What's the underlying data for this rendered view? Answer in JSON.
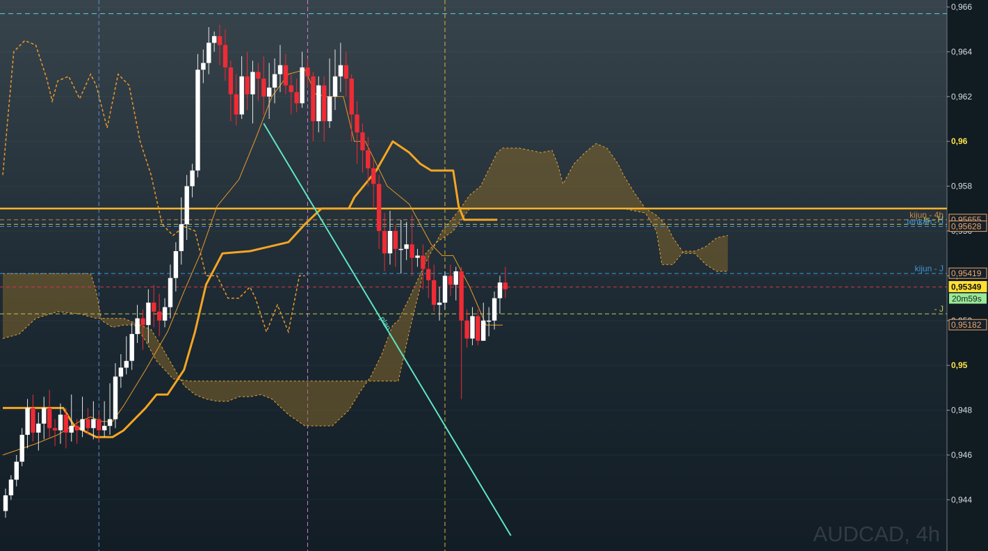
{
  "chart_data": {
    "type": "candlestick",
    "symbol_label": "AUDCAD, 4h",
    "ylim": [
      0.9425,
      0.9665
    ],
    "y_ticks": [
      {
        "v": 0.966,
        "label": "0,966",
        "bold": false
      },
      {
        "v": 0.964,
        "label": "0,964",
        "bold": false
      },
      {
        "v": 0.962,
        "label": "0,962",
        "bold": false
      },
      {
        "v": 0.96,
        "label": "0,96",
        "bold": true
      },
      {
        "v": 0.958,
        "label": "0,958",
        "bold": false
      },
      {
        "v": 0.956,
        "label": "0,956",
        "bold": false
      },
      {
        "v": 0.954,
        "label": "0,954",
        "bold": false
      },
      {
        "v": 0.952,
        "label": "0,952",
        "bold": false
      },
      {
        "v": 0.95,
        "label": "0,95",
        "bold": true
      },
      {
        "v": 0.948,
        "label": "0,948",
        "bold": false
      },
      {
        "v": 0.946,
        "label": "0,946",
        "bold": false
      },
      {
        "v": 0.944,
        "label": "0,944",
        "bold": false
      }
    ],
    "bar_count": 92,
    "vertical_markers": [
      {
        "bar": 17.5,
        "color": "#5b8fd6"
      },
      {
        "bar": 55.5,
        "color": "#d77ad8"
      },
      {
        "bar": 80.5,
        "color": "#e0b43c"
      }
    ],
    "candles": [
      [
        0.9435,
        0.9442,
        0.9432,
        0.9445
      ],
      [
        0.9442,
        0.9449,
        0.944,
        0.9451
      ],
      [
        0.9449,
        0.9457,
        0.9446,
        0.946
      ],
      [
        0.9457,
        0.9469,
        0.9455,
        0.9472
      ],
      [
        0.9469,
        0.9481,
        0.9463,
        0.9485
      ],
      [
        0.9481,
        0.947,
        0.9466,
        0.9487
      ],
      [
        0.947,
        0.9474,
        0.9462,
        0.9479
      ],
      [
        0.9474,
        0.9481,
        0.9467,
        0.9486
      ],
      [
        0.9481,
        0.9472,
        0.9468,
        0.9489
      ],
      [
        0.9472,
        0.9471,
        0.9464,
        0.9476
      ],
      [
        0.9471,
        0.9478,
        0.9465,
        0.9483
      ],
      [
        0.9478,
        0.947,
        0.9463,
        0.9481
      ],
      [
        0.947,
        0.9473,
        0.9466,
        0.9487
      ],
      [
        0.9473,
        0.9471,
        0.9465,
        0.9476
      ],
      [
        0.9471,
        0.9476,
        0.9468,
        0.9486
      ],
      [
        0.9476,
        0.9472,
        0.9469,
        0.9481
      ],
      [
        0.9472,
        0.9476,
        0.9467,
        0.9484
      ],
      [
        0.9476,
        0.9471,
        0.9466,
        0.9479
      ],
      [
        0.9471,
        0.9473,
        0.9468,
        0.9484
      ],
      [
        0.9473,
        0.9476,
        0.9469,
        0.9492
      ],
      [
        0.9476,
        0.9495,
        0.9472,
        0.9501
      ],
      [
        0.9495,
        0.9499,
        0.949,
        0.9505
      ],
      [
        0.9499,
        0.9502,
        0.9496,
        0.9513
      ],
      [
        0.9502,
        0.9514,
        0.9498,
        0.9519
      ],
      [
        0.9514,
        0.9521,
        0.951,
        0.9527
      ],
      [
        0.9521,
        0.9518,
        0.9507,
        0.9525
      ],
      [
        0.9518,
        0.9528,
        0.951,
        0.9534
      ],
      [
        0.9528,
        0.9524,
        0.9517,
        0.9536
      ],
      [
        0.9524,
        0.952,
        0.9513,
        0.9532
      ],
      [
        0.952,
        0.9526,
        0.9517,
        0.953
      ],
      [
        0.9526,
        0.9539,
        0.9521,
        0.9545
      ],
      [
        0.9539,
        0.9551,
        0.9533,
        0.9555
      ],
      [
        0.9551,
        0.9563,
        0.9545,
        0.9575
      ],
      [
        0.9563,
        0.958,
        0.9556,
        0.9585
      ],
      [
        0.958,
        0.9587,
        0.9575,
        0.959
      ],
      [
        0.9587,
        0.9632,
        0.9584,
        0.9639
      ],
      [
        0.9632,
        0.9635,
        0.9626,
        0.9641
      ],
      [
        0.9635,
        0.9644,
        0.963,
        0.9651
      ],
      [
        0.9644,
        0.9647,
        0.964,
        0.9649
      ],
      [
        0.9647,
        0.9643,
        0.9634,
        0.9652
      ],
      [
        0.9643,
        0.9633,
        0.9627,
        0.965
      ],
      [
        0.9633,
        0.9621,
        0.9609,
        0.9636
      ],
      [
        0.9621,
        0.9612,
        0.9607,
        0.963
      ],
      [
        0.9612,
        0.9629,
        0.961,
        0.9638
      ],
      [
        0.9629,
        0.9621,
        0.9614,
        0.964
      ],
      [
        0.9621,
        0.9631,
        0.9608,
        0.9636
      ],
      [
        0.9631,
        0.9628,
        0.9618,
        0.9635
      ],
      [
        0.9628,
        0.962,
        0.9612,
        0.9638
      ],
      [
        0.962,
        0.9624,
        0.961,
        0.9635
      ],
      [
        0.9624,
        0.963,
        0.9617,
        0.9637
      ],
      [
        0.963,
        0.9634,
        0.9622,
        0.9643
      ],
      [
        0.9634,
        0.9625,
        0.9621,
        0.9639
      ],
      [
        0.9625,
        0.9622,
        0.9612,
        0.963
      ],
      [
        0.9622,
        0.9617,
        0.9613,
        0.9628
      ],
      [
        0.9617,
        0.9633,
        0.9615,
        0.964
      ],
      [
        0.9633,
        0.9629,
        0.9624,
        0.9637
      ],
      [
        0.9629,
        0.9609,
        0.96,
        0.9631
      ],
      [
        0.9609,
        0.9625,
        0.9604,
        0.9629
      ],
      [
        0.9625,
        0.9609,
        0.96,
        0.9629
      ],
      [
        0.9609,
        0.962,
        0.9606,
        0.9637
      ],
      [
        0.962,
        0.9629,
        0.9614,
        0.9641
      ],
      [
        0.9629,
        0.9634,
        0.9622,
        0.9644
      ],
      [
        0.9634,
        0.9628,
        0.962,
        0.964
      ],
      [
        0.9628,
        0.9612,
        0.96,
        0.963
      ],
      [
        0.9612,
        0.9604,
        0.959,
        0.9618
      ],
      [
        0.9604,
        0.9596,
        0.9586,
        0.9608
      ],
      [
        0.9596,
        0.9588,
        0.958,
        0.9602
      ],
      [
        0.9588,
        0.9581,
        0.957,
        0.9592
      ],
      [
        0.9581,
        0.956,
        0.9552,
        0.9585
      ],
      [
        0.956,
        0.955,
        0.9542,
        0.9568
      ],
      [
        0.955,
        0.956,
        0.9545,
        0.9569
      ],
      [
        0.956,
        0.9552,
        0.9544,
        0.9563
      ],
      [
        0.9552,
        0.9552,
        0.9541,
        0.9565
      ],
      [
        0.9552,
        0.9554,
        0.9547,
        0.9564
      ],
      [
        0.9554,
        0.9548,
        0.954,
        0.9567
      ],
      [
        0.9548,
        0.9549,
        0.9544,
        0.9552
      ],
      [
        0.9549,
        0.9543,
        0.9534,
        0.9554
      ],
      [
        0.9543,
        0.9538,
        0.953,
        0.9548
      ],
      [
        0.9538,
        0.9527,
        0.9524,
        0.9545
      ],
      [
        0.9527,
        0.9528,
        0.952,
        0.9535
      ],
      [
        0.9528,
        0.954,
        0.9525,
        0.9542
      ],
      [
        0.954,
        0.9536,
        0.9531,
        0.9545
      ],
      [
        0.9536,
        0.9542,
        0.9529,
        0.9544
      ],
      [
        0.9542,
        0.952,
        0.9485,
        0.9544
      ],
      [
        0.952,
        0.9512,
        0.9508,
        0.9525
      ],
      [
        0.9512,
        0.9522,
        0.9509,
        0.9526
      ],
      [
        0.9522,
        0.9511,
        0.9509,
        0.9525
      ],
      [
        0.9511,
        0.952,
        0.9511,
        0.9528
      ],
      [
        0.952,
        0.952,
        0.9513,
        0.9526
      ],
      [
        0.952,
        0.953,
        0.9516,
        0.9533
      ],
      [
        0.953,
        0.9537,
        0.9523,
        0.954
      ],
      [
        0.9537,
        0.9534,
        0.953,
        0.9544
      ]
    ],
    "kijun_thick": [
      [
        0,
        0.9481
      ],
      [
        11,
        0.9481
      ],
      [
        13,
        0.9473
      ],
      [
        17,
        0.9468
      ],
      [
        20,
        0.9468
      ],
      [
        22,
        0.9471
      ],
      [
        26,
        0.9481
      ],
      [
        28,
        0.9487
      ],
      [
        30,
        0.9487
      ],
      [
        33,
        0.9498
      ],
      [
        35,
        0.9515
      ],
      [
        37,
        0.9536
      ],
      [
        40,
        0.955
      ],
      [
        45,
        0.9551
      ],
      [
        52,
        0.9555
      ],
      [
        55,
        0.9563
      ],
      [
        58,
        0.957
      ],
      [
        63,
        0.957
      ],
      [
        64,
        0.9575
      ],
      [
        68,
        0.9587
      ],
      [
        71,
        0.96
      ],
      [
        74,
        0.9595
      ],
      [
        76,
        0.959
      ],
      [
        78,
        0.9587
      ],
      [
        82,
        0.9587
      ],
      [
        83,
        0.9571
      ],
      [
        84,
        0.9565
      ],
      [
        90,
        0.9565
      ]
    ],
    "tenkan_thin": [
      [
        0,
        0.946
      ],
      [
        6,
        0.9465
      ],
      [
        10,
        0.9469
      ],
      [
        14,
        0.9475
      ],
      [
        16,
        0.9477
      ],
      [
        18,
        0.9475
      ],
      [
        20,
        0.9475
      ],
      [
        22,
        0.9482
      ],
      [
        26,
        0.9498
      ],
      [
        30,
        0.9515
      ],
      [
        33,
        0.9533
      ],
      [
        36,
        0.955
      ],
      [
        39,
        0.9571
      ],
      [
        43,
        0.9583
      ],
      [
        46,
        0.9601
      ],
      [
        49,
        0.962
      ],
      [
        52,
        0.963
      ],
      [
        55,
        0.9632
      ],
      [
        57,
        0.9621
      ],
      [
        59,
        0.962
      ],
      [
        62,
        0.962
      ],
      [
        64,
        0.96
      ],
      [
        66,
        0.96
      ],
      [
        70,
        0.958
      ],
      [
        74,
        0.9572
      ],
      [
        76,
        0.9563
      ],
      [
        78,
        0.9554
      ],
      [
        80,
        0.9549
      ],
      [
        82,
        0.9549
      ],
      [
        85,
        0.9535
      ],
      [
        88,
        0.9518
      ],
      [
        91,
        0.9518
      ]
    ],
    "chikou_dashed": [
      [
        0,
        0.9585
      ],
      [
        2,
        0.964
      ],
      [
        4,
        0.9645
      ],
      [
        6,
        0.9643
      ],
      [
        8,
        0.9628
      ],
      [
        9,
        0.9618
      ],
      [
        10,
        0.9627
      ],
      [
        12,
        0.9629
      ],
      [
        14,
        0.9619
      ],
      [
        16,
        0.963
      ],
      [
        17,
        0.9625
      ],
      [
        19,
        0.9606
      ],
      [
        21,
        0.963
      ],
      [
        23,
        0.9625
      ],
      [
        25,
        0.96
      ],
      [
        27,
        0.9585
      ],
      [
        29,
        0.9563
      ],
      [
        31,
        0.9558
      ],
      [
        33,
        0.9562
      ],
      [
        35,
        0.956
      ],
      [
        37,
        0.954
      ],
      [
        39,
        0.954
      ],
      [
        41,
        0.953
      ],
      [
        43,
        0.953
      ],
      [
        45,
        0.9535
      ],
      [
        46,
        0.953
      ],
      [
        48,
        0.9515
      ],
      [
        50,
        0.9527
      ],
      [
        52,
        0.9515
      ],
      [
        54,
        0.954
      ],
      [
        55,
        0.954
      ]
    ],
    "span_a": [
      [
        0,
        0.9512
      ],
      [
        3,
        0.9514
      ],
      [
        6,
        0.9521
      ],
      [
        10,
        0.9524
      ],
      [
        14,
        0.9523
      ],
      [
        17,
        0.9521
      ],
      [
        22,
        0.9521
      ],
      [
        24,
        0.9519
      ],
      [
        27,
        0.9516
      ],
      [
        29,
        0.9508
      ],
      [
        33,
        0.9491
      ],
      [
        35,
        0.9487
      ],
      [
        37,
        0.9485
      ],
      [
        39,
        0.9484
      ],
      [
        41,
        0.9484
      ],
      [
        43,
        0.9486
      ],
      [
        45,
        0.9486
      ],
      [
        47,
        0.9487
      ],
      [
        49,
        0.9485
      ],
      [
        52,
        0.9478
      ],
      [
        55,
        0.9473
      ],
      [
        60,
        0.9473
      ],
      [
        63,
        0.948
      ],
      [
        65,
        0.9488
      ],
      [
        67,
        0.9495
      ],
      [
        69,
        0.9505
      ],
      [
        71,
        0.9518
      ],
      [
        72,
        0.952
      ],
      [
        74,
        0.953
      ],
      [
        77,
        0.9546
      ],
      [
        80,
        0.956
      ],
      [
        83,
        0.9569
      ],
      [
        85,
        0.9576
      ],
      [
        87,
        0.958
      ],
      [
        88,
        0.9585
      ],
      [
        90,
        0.9595
      ],
      [
        91,
        0.9597
      ],
      [
        94,
        0.9597
      ],
      [
        96,
        0.9596
      ],
      [
        98,
        0.9595
      ],
      [
        100,
        0.9596
      ],
      [
        101,
        0.959
      ],
      [
        102,
        0.9581
      ],
      [
        104,
        0.959
      ],
      [
        106,
        0.9595
      ],
      [
        108,
        0.9599
      ],
      [
        110,
        0.9597
      ],
      [
        112,
        0.959
      ],
      [
        113,
        0.9585
      ],
      [
        115,
        0.9577
      ],
      [
        117,
        0.957
      ],
      [
        119,
        0.9567
      ],
      [
        121,
        0.9562
      ],
      [
        122,
        0.9557
      ],
      [
        124,
        0.955
      ],
      [
        126,
        0.955
      ],
      [
        128,
        0.9545
      ],
      [
        130,
        0.9542
      ],
      [
        132,
        0.9542
      ]
    ],
    "span_b": [
      [
        0,
        0.9541
      ],
      [
        3,
        0.9541
      ],
      [
        8,
        0.9541
      ],
      [
        12,
        0.9541
      ],
      [
        16,
        0.9541
      ],
      [
        17,
        0.9533
      ],
      [
        18,
        0.952
      ],
      [
        20,
        0.9517
      ],
      [
        22,
        0.9518
      ],
      [
        24,
        0.9518
      ],
      [
        26,
        0.9511
      ],
      [
        28,
        0.9502
      ],
      [
        31,
        0.9494
      ],
      [
        34,
        0.9493
      ],
      [
        37,
        0.9493
      ],
      [
        40,
        0.9493
      ],
      [
        43,
        0.9493
      ],
      [
        47,
        0.9493
      ],
      [
        52,
        0.9493
      ],
      [
        57,
        0.9493
      ],
      [
        62,
        0.9493
      ],
      [
        67,
        0.9493
      ],
      [
        70,
        0.9493
      ],
      [
        72,
        0.9493
      ],
      [
        74,
        0.9515
      ],
      [
        76,
        0.9535
      ],
      [
        77,
        0.955
      ],
      [
        79,
        0.9555
      ],
      [
        82,
        0.956
      ],
      [
        85,
        0.957
      ],
      [
        90,
        0.957
      ],
      [
        94,
        0.957
      ],
      [
        98,
        0.957
      ],
      [
        103,
        0.957
      ],
      [
        108,
        0.957
      ],
      [
        113,
        0.957
      ],
      [
        117,
        0.9568
      ],
      [
        119,
        0.956
      ],
      [
        120,
        0.9545
      ],
      [
        122,
        0.9545
      ],
      [
        124,
        0.9551
      ],
      [
        126,
        0.9551
      ],
      [
        128,
        0.9553
      ],
      [
        130,
        0.9557
      ],
      [
        132,
        0.9558
      ]
    ],
    "trend_line": {
      "from": [
        47.5,
        0.9608
      ],
      "to": [
        92.5,
        0.9424
      ],
      "label": "plan"
    },
    "h_lines": [
      {
        "v": 0.9657,
        "label": "",
        "color": "#5ad2e8",
        "dash": "7,5",
        "width": 1
      },
      {
        "v": 0.957,
        "label": "",
        "color": "#f5b22a",
        "dash": "",
        "width": 2.5
      },
      {
        "v": 0.9565,
        "label": "kijun - 4h",
        "color": "#c88a4a",
        "dash": "6,4",
        "width": 1
      },
      {
        "v": 0.9563,
        "label": "ts - H",
        "color": "#c9c35a",
        "dash": "6,4",
        "width": 1
      },
      {
        "v": 0.9562,
        "label": "tenkan - J",
        "color": "#3f96d6",
        "dash": "6,4",
        "width": 1
      },
      {
        "v": 0.9541,
        "label": "kijun - J",
        "color": "#3f96d6",
        "dash": "6,4",
        "width": 1
      },
      {
        "v": 0.9535,
        "label": "",
        "color": "#d8344a",
        "dash": "5,4",
        "width": 1
      },
      {
        "v": 0.9523,
        "label": "- J",
        "color": "#c9c35a",
        "dash": "6,4",
        "width": 1
      }
    ],
    "price_tags": [
      {
        "v": 0.9565,
        "label": "0,95655",
        "bg": "#14202a",
        "fg": "#f0a86a",
        "border": "#f0a86a"
      },
      {
        "v": 0.9562,
        "label": "0,95628",
        "bg": "#14202a",
        "fg": "#f0a86a",
        "border": "#f0a86a"
      },
      {
        "v": 0.9541,
        "label": "0,95419",
        "bg": "#14202a",
        "fg": "#f0a86a",
        "border": "#f0a86a"
      },
      {
        "v": 0.9535,
        "label": "0,95349",
        "bg": "#ffe033",
        "fg": "#111111",
        "border": "#ffe033"
      },
      {
        "v": 0.9518,
        "label": "0,95182",
        "bg": "#14202a",
        "fg": "#f0a86a",
        "border": "#f0a86a"
      }
    ],
    "countdown": {
      "v": 0.9535,
      "label": "20m59s"
    }
  }
}
